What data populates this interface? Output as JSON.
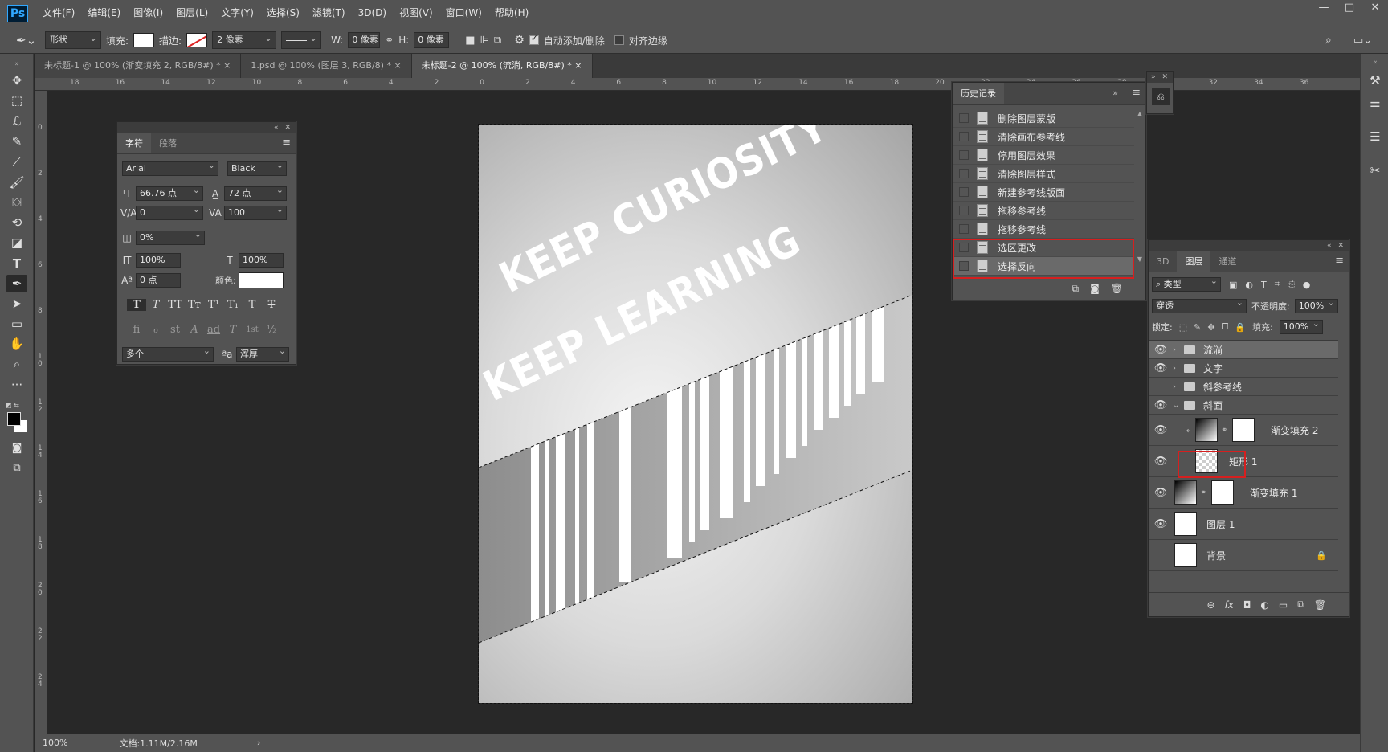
{
  "app": {
    "logo": "Ps"
  },
  "menu": [
    "文件(F)",
    "编辑(E)",
    "图像(I)",
    "图层(L)",
    "文字(Y)",
    "选择(S)",
    "滤镜(T)",
    "3D(D)",
    "视图(V)",
    "窗口(W)",
    "帮助(H)"
  ],
  "window_controls": [
    "—",
    "□",
    "✕"
  ],
  "options": {
    "mode": "形状",
    "fill_label": "填充:",
    "stroke_label": "描边:",
    "stroke_width": "2 像素",
    "w_label": "W:",
    "w_value": "0 像素",
    "h_label": "H:",
    "h_value": "0 像素",
    "auto_add": "自动添加/删除",
    "align_edges": "对齐边缘"
  },
  "tabs": [
    {
      "label": "未标题-1 @ 100% (渐变填充 2, RGB/8#) *",
      "close": "×"
    },
    {
      "label": "1.psd @ 100% (图层 3, RGB/8) *",
      "close": "×"
    },
    {
      "label": "未标题-2 @ 100% (流淌, RGB/8#) *",
      "close": "×"
    }
  ],
  "ruler_top": [
    "18",
    "16",
    "14",
    "12",
    "10",
    "8",
    "6",
    "4",
    "2",
    "0",
    "2",
    "4",
    "6",
    "8",
    "10",
    "12",
    "14",
    "16",
    "18",
    "20",
    "22",
    "24",
    "26",
    "28",
    "30",
    "32",
    "34",
    "36"
  ],
  "ruler_left": [
    "0",
    "2",
    "4",
    "6",
    "8",
    "1\n0",
    "1\n2",
    "1\n4",
    "1\n6",
    "1\n8",
    "2\n0",
    "2\n2",
    "2\n4"
  ],
  "status": {
    "zoom": "100%",
    "doc": "文档:1.11M/2.16M",
    "arrow": "›"
  },
  "canvas": {
    "line1": "KEEP CURIOSITY",
    "line2": "KEEP LEARNING"
  },
  "character": {
    "tabs": [
      "字符",
      "段落"
    ],
    "font": "Arial",
    "style": "Black",
    "size": "66.76 点",
    "leading": "72 点",
    "kerning": "0",
    "tracking": "100",
    "scale_pct": "0%",
    "vscale": "100%",
    "hscale": "100%",
    "baseline": "0 点",
    "color_label": "颜色:",
    "format_row1": [
      "T",
      "T",
      "TT",
      "Tт",
      "T¹",
      "T₁",
      "T",
      "T"
    ],
    "format_row2": [
      "fi",
      "ℴ",
      "st",
      "A",
      "ad",
      "T",
      "1st",
      "½"
    ],
    "language": "多个",
    "aa_label": "ªa",
    "aa_mode": "浑厚"
  },
  "history": {
    "title": "历史记录",
    "items": [
      "删除图层蒙版",
      "清除画布参考线",
      "停用图层效果",
      "清除图层样式",
      "新建参考线版面",
      "拖移参考线",
      "拖移参考线",
      "选区更改",
      "选择反向"
    ]
  },
  "layers": {
    "tabs": [
      "3D",
      "图层",
      "通道"
    ],
    "filter": "类型",
    "blend": "穿透",
    "opacity_label": "不透明度:",
    "opacity": "100%",
    "lock_label": "锁定:",
    "fill_label": "填充:",
    "fill": "100%",
    "items": [
      {
        "name": "流淌",
        "kind": "group"
      },
      {
        "name": "文字",
        "kind": "group"
      },
      {
        "name": "斜参考线",
        "kind": "group"
      },
      {
        "name": "斜面",
        "kind": "group-open"
      },
      {
        "name": "渐变填充 2",
        "kind": "fill"
      },
      {
        "name": "矩形 1",
        "kind": "shape"
      },
      {
        "name": "渐变填充 1",
        "kind": "fill"
      },
      {
        "name": "图层 1",
        "kind": "layer"
      },
      {
        "name": "背景",
        "kind": "background"
      }
    ],
    "footer_icons": [
      "⊖",
      "fx",
      "◘",
      "◐",
      "▭",
      "⧉",
      "🗑"
    ]
  }
}
